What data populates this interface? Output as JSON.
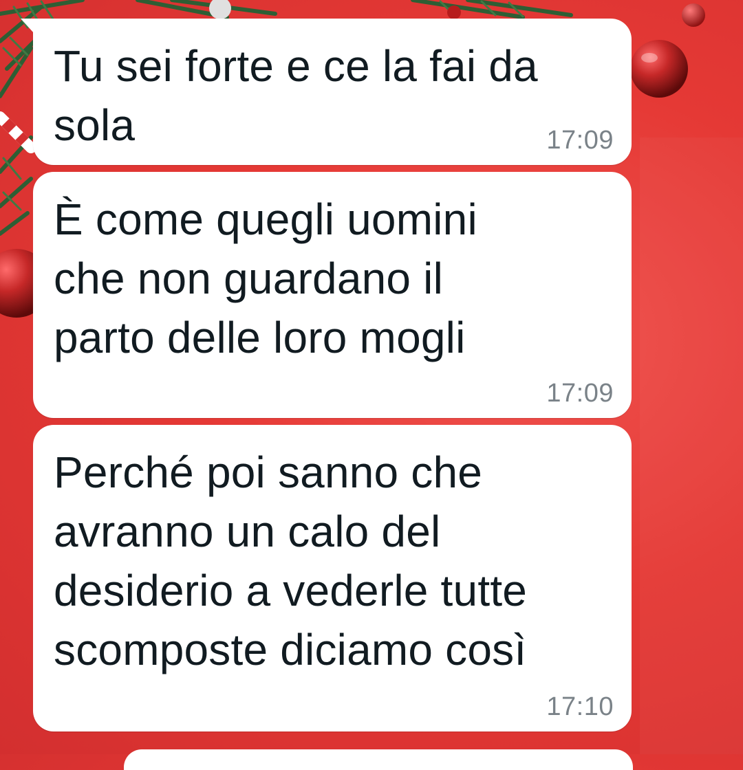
{
  "wallpaper": {
    "theme": "christmas-red",
    "base_color": "#e53935",
    "decorations": [
      "pine-branch-icon",
      "ornament-ball-icon",
      "candy-cane-icon"
    ]
  },
  "messages": [
    {
      "text": "Tu sei forte e ce la fai da\nsola",
      "time": "17:09"
    },
    {
      "text": "È come quegli uomini\nche non guardano il\nparto delle loro mogli",
      "time": "17:09"
    },
    {
      "text": "Perché poi sanno che\navranno un calo del\ndesiderio a vederle tutte\nscomposte diciamo così",
      "time": "17:10"
    }
  ],
  "colors": {
    "bubble": "#ffffff",
    "text": "#111b21",
    "timestamp": "#7a8288"
  }
}
